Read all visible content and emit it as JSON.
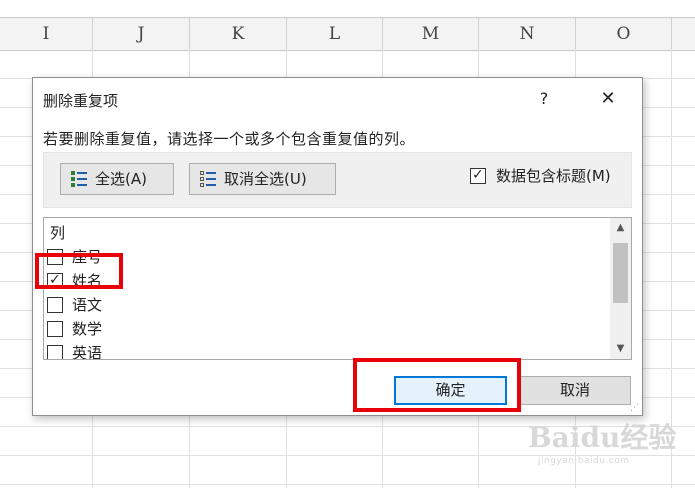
{
  "spreadsheet": {
    "columns": [
      "I",
      "J",
      "K",
      "L",
      "M",
      "N",
      "O"
    ]
  },
  "dialog": {
    "title": "删除重复项",
    "help_label": "?",
    "close_label": "✕",
    "instruction": "若要删除重复值，请选择一个或多个包含重复值的列。",
    "select_all_label": "全选(A)",
    "unselect_all_label": "取消全选(U)",
    "has_headers_label": "数据包含标题(M)",
    "has_headers_checked": true,
    "list_header": "列",
    "columns": [
      {
        "label": "座号",
        "checked": false
      },
      {
        "label": "姓名",
        "checked": true
      },
      {
        "label": "语文",
        "checked": false
      },
      {
        "label": "数学",
        "checked": false
      },
      {
        "label": "英语",
        "checked": false
      }
    ],
    "ok_label": "确定",
    "cancel_label": "取消"
  },
  "annotation_color": "#e8000b",
  "watermark": {
    "logo": "Baidu经验",
    "url": "jingyan.baidu.com"
  }
}
